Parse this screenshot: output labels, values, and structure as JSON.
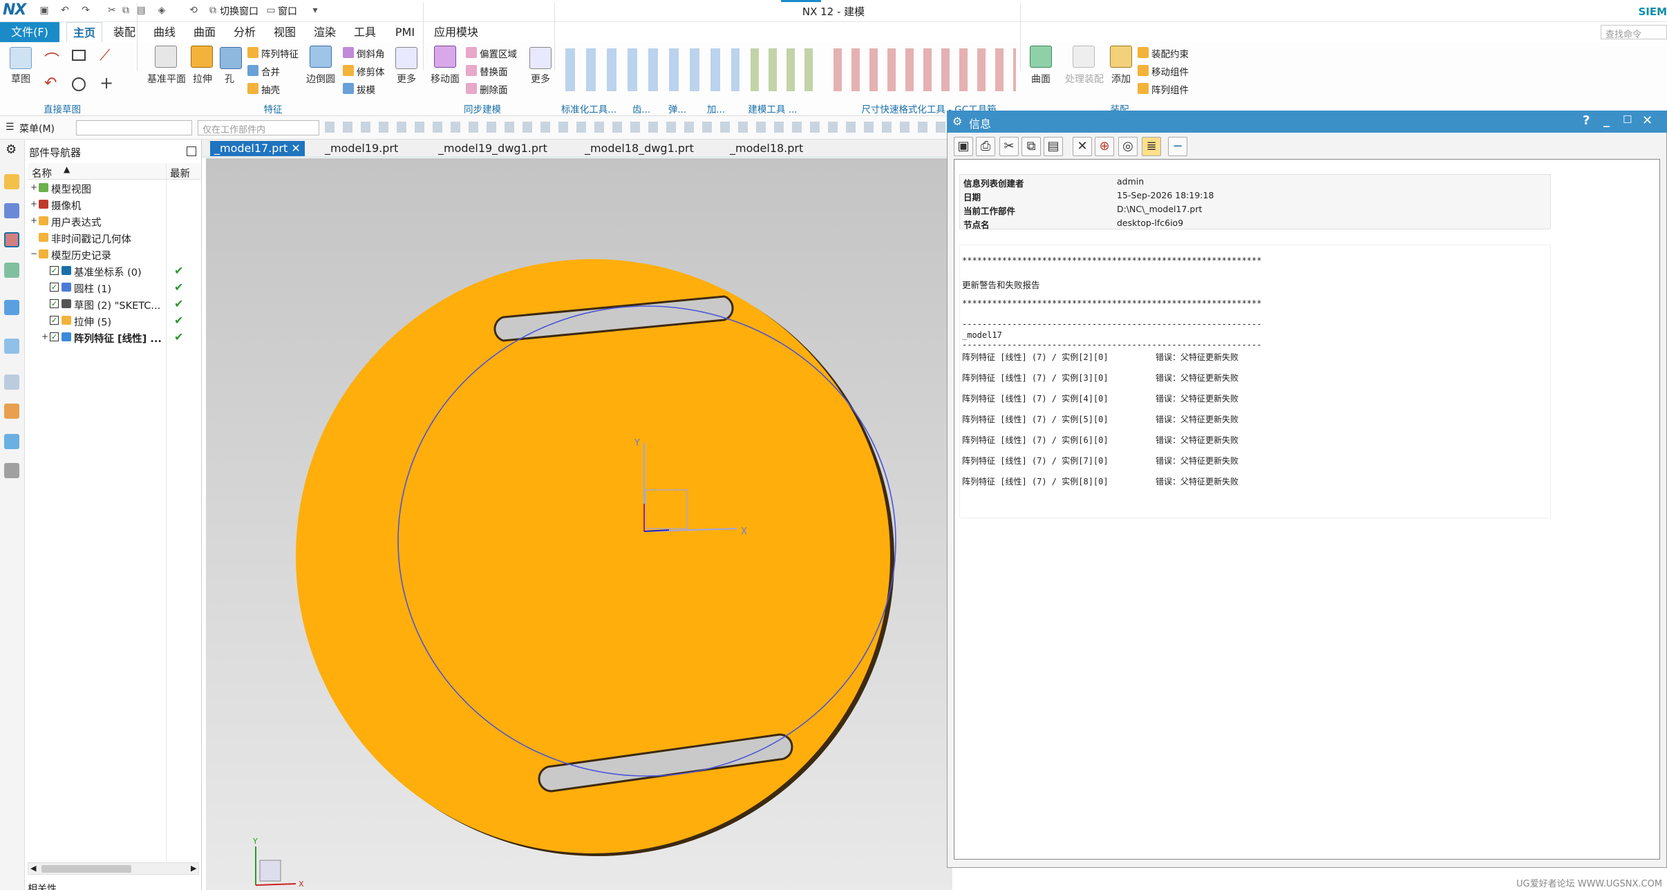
{
  "titlebar": {
    "logo": "NX",
    "switch_window": "切换窗口",
    "window_menu": "窗口",
    "title": "NX 12 - 建模",
    "brand": "SIEM",
    "search_placeholder": "查找命令"
  },
  "menubar": {
    "file": "文件(F)",
    "tabs": [
      "主页",
      "装配",
      "曲线",
      "曲面",
      "分析",
      "视图",
      "渲染",
      "工具",
      "PMI",
      "应用模块"
    ],
    "active_tab": "主页"
  },
  "ribbon": {
    "sketch": "草图",
    "group_direct_sketch": "直接草图",
    "datum_plane": "基准平面",
    "extrude": "拉伸",
    "hole": "孔",
    "pattern_feature": "阵列特征",
    "unite": "合并",
    "shell": "抽壳",
    "edge_blend": "边倒圆",
    "chamfer": "倒斜角",
    "trim_body": "修剪体",
    "draft": "拔模",
    "more1": "更多",
    "group_feature": "特征",
    "move_face": "移动面",
    "offset_region": "偏置区域",
    "replace_face": "替换面",
    "delete_face": "删除面",
    "more2": "更多",
    "group_sync": "同步建模",
    "group_std": "标准化工具...",
    "group_gear": "齿...",
    "group_spring": "弹...",
    "group_add": "加...",
    "group_build": "建模工具 ...",
    "group_dim": "尺寸快速格式化工具 - GC工具箱",
    "surface": "曲面",
    "process_asm": "处理装配",
    "add": "添加",
    "asm_constraint": "装配约束",
    "move_component": "移动组件",
    "pattern_component": "阵列组件",
    "group_asm": "装配"
  },
  "toolbar2": {
    "menu": "菜单(M)",
    "filter_placeholder": "仅在工作部件内"
  },
  "navigator": {
    "title": "部件导航器",
    "col_name": "名称",
    "col_latest": "最新",
    "rows": [
      {
        "label": "模型视图",
        "level": 0,
        "exp": "+",
        "check": ""
      },
      {
        "label": "摄像机",
        "level": 0,
        "exp": "+",
        "check": ""
      },
      {
        "label": "用户表达式",
        "level": 0,
        "exp": "+",
        "check": ""
      },
      {
        "label": "非时间戳记几何体",
        "level": 0,
        "exp": "",
        "check": ""
      },
      {
        "label": "模型历史记录",
        "level": 0,
        "exp": "−",
        "check": ""
      },
      {
        "label": "基准坐标系 (0)",
        "level": 1,
        "exp": "",
        "check": "✔"
      },
      {
        "label": "圆柱 (1)",
        "level": 1,
        "exp": "",
        "check": "✔"
      },
      {
        "label": "草图 (2) \"SKETC...",
        "level": 1,
        "exp": "",
        "check": "✔"
      },
      {
        "label": "拉伸 (5)",
        "level": 1,
        "exp": "",
        "check": "✔"
      },
      {
        "label": "阵列特征 [线性] ...",
        "level": 1,
        "exp": "+",
        "check": "✔",
        "bold": true
      }
    ],
    "bottom_tab": "相关性"
  },
  "doc_tabs": [
    "_model17.prt",
    "_model19.prt",
    "_model19_dwg1.prt",
    "_model18_dwg1.prt",
    "_model18.prt"
  ],
  "axis": {
    "x": "X",
    "y": "Y"
  },
  "info": {
    "title": "信息",
    "fields": [
      {
        "k": "信息列表创建者",
        "v": "admin"
      },
      {
        "k": "日期",
        "v": "15-Sep-2026 18:19:18"
      },
      {
        "k": "当前工作部件",
        "v": "D:\\NC\\_model17.prt"
      },
      {
        "k": "节点名",
        "v": "desktop-lfc6io9"
      }
    ],
    "stars": "************************************************************",
    "report_title": "更新警告和失败报告",
    "dashes": "------------------------------------------------------------",
    "part": "_model17",
    "errors": [
      {
        "feat": "阵列特征 [线性] (7) / 实例[2][0]",
        "msg": "错误：父特征更新失败"
      },
      {
        "feat": "阵列特征 [线性] (7) / 实例[3][0]",
        "msg": "错误：父特征更新失败"
      },
      {
        "feat": "阵列特征 [线性] (7) / 实例[4][0]",
        "msg": "错误：父特征更新失败"
      },
      {
        "feat": "阵列特征 [线性] (7) / 实例[5][0]",
        "msg": "错误：父特征更新失败"
      },
      {
        "feat": "阵列特征 [线性] (7) / 实例[6][0]",
        "msg": "错误：父特征更新失败"
      },
      {
        "feat": "阵列特征 [线性] (7) / 实例[7][0]",
        "msg": "错误：父特征更新失败"
      },
      {
        "feat": "阵列特征 [线性] (7) / 实例[8][0]",
        "msg": "错误：父特征更新失败"
      }
    ]
  },
  "footer": "UG爱好者论坛 WWW.UGSNX.COM",
  "colors": {
    "accent": "#1a8bc8",
    "part": "#ffae0c",
    "dialog_title": "#3c90c8"
  }
}
